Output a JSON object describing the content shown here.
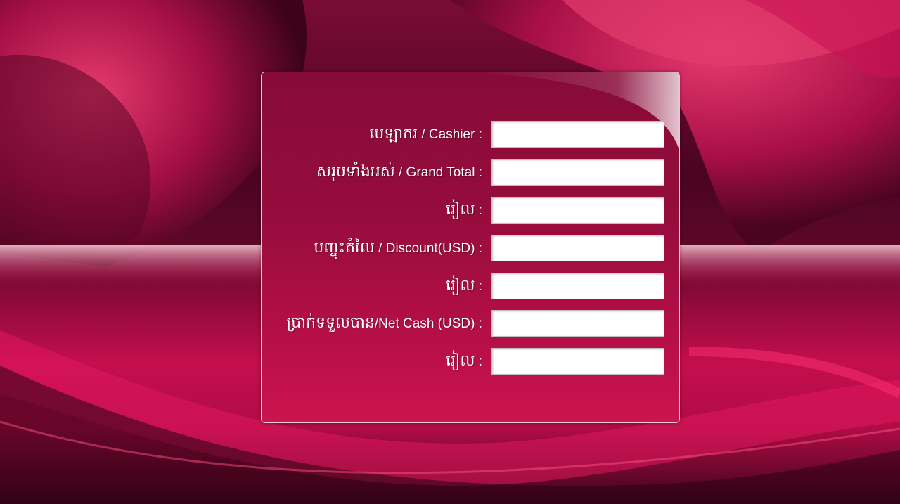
{
  "form": {
    "rows": [
      {
        "label_km": "បេឡាករ",
        "label_en": " / Cashier :",
        "value": ""
      },
      {
        "label_km": "សរុបទាំងអស់",
        "label_en": " / Grand Total :",
        "value": ""
      },
      {
        "label_km": "រៀល",
        "label_en": " :",
        "value": ""
      },
      {
        "label_km": "បញ្ចុះតំលៃ",
        "label_en": " / Discount(USD) :",
        "value": ""
      },
      {
        "label_km": "រៀល",
        "label_en": " :",
        "value": ""
      },
      {
        "label_km": "ប្រាក់ទទួលបាន",
        "label_en": "/Net Cash (USD) :",
        "value": ""
      },
      {
        "label_km": "រៀល",
        "label_en": " :",
        "value": ""
      }
    ]
  },
  "colors": {
    "panel_top": "#860b37",
    "panel_bottom": "#cb1450",
    "background_accent": "#e0185c"
  }
}
